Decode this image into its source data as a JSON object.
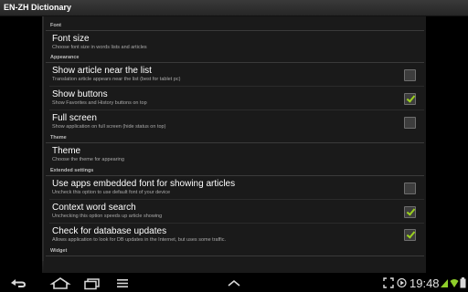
{
  "app": {
    "title": "EN-ZH Dictionary"
  },
  "sections": {
    "font": "Font",
    "appearance": "Appearance",
    "theme": "Theme",
    "extended": "Extended settings",
    "widget": "Widget"
  },
  "rows": {
    "font_size": {
      "title": "Font size",
      "sub": "Choose font size in words lists and articles"
    },
    "show_article": {
      "title": "Show article near the list",
      "sub": "Translation article appears near the list (best for tablet pc)",
      "checked": false
    },
    "show_buttons": {
      "title": "Show buttons",
      "sub": "Show Favorites and History buttons on top",
      "checked": true
    },
    "full_screen": {
      "title": "Full screen",
      "sub": "Show application on full screen (hide status on top)",
      "checked": false
    },
    "theme": {
      "title": "Theme",
      "sub": "Choose the theme for appearing"
    },
    "embedded_font": {
      "title": "Use apps embedded font for showing articles",
      "sub": "Uncheck this option to use default font of your device",
      "checked": false
    },
    "context_search": {
      "title": "Context word search",
      "sub": "Unchecking this option speeds up article showing",
      "checked": true
    },
    "db_updates": {
      "title": "Check for database updates",
      "sub": "Allows application to look for DB updates in the Internet, but uses some traffic.",
      "checked": true
    }
  },
  "statusbar": {
    "time": "19:48"
  },
  "colors": {
    "check_green": "#9bd11f",
    "panel": "#1a1a1a",
    "title_bar": "#2f2f2f"
  },
  "icons": [
    "back-icon",
    "home-icon",
    "recent-apps-icon",
    "menu-icon",
    "up-chevron-icon",
    "screenshot-icon",
    "media-icon",
    "signal-icon",
    "wifi-icon",
    "battery-icon"
  ]
}
